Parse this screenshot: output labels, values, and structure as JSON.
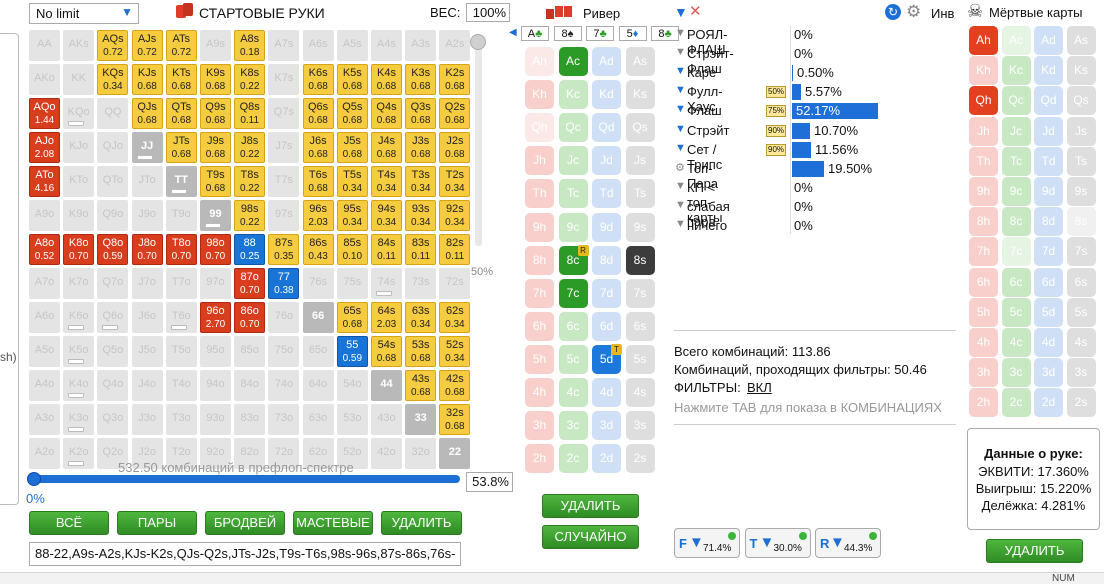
{
  "top": {
    "limit": "No limit",
    "title": "СТАРТОВЫЕ РУКИ",
    "weight_label": "ВЕС:",
    "weight_value": "100%",
    "slider_pct": "50%"
  },
  "grid": [
    [
      [
        "AA",
        "",
        "",
        "e"
      ],
      [
        "AKs",
        "",
        "",
        "e"
      ],
      [
        "AQs",
        "0.72",
        "",
        "y"
      ],
      [
        "AJs",
        "0.72",
        "",
        "y"
      ],
      [
        "ATs",
        "0.72",
        "",
        "y"
      ],
      [
        "A9s",
        "",
        "",
        "e"
      ],
      [
        "A8s",
        "0.18",
        "",
        "y"
      ],
      [
        "A7s",
        "",
        "",
        "e"
      ],
      [
        "A6s",
        "",
        "",
        "e"
      ],
      [
        "A5s",
        "",
        "",
        "e"
      ],
      [
        "A4s",
        "",
        "",
        "e"
      ],
      [
        "A3s",
        "",
        "",
        "e"
      ],
      [
        "A2s",
        "",
        "",
        "e"
      ]
    ],
    [
      [
        "AKo",
        "",
        "",
        "e"
      ],
      [
        "KK",
        "",
        "",
        "e"
      ],
      [
        "KQs",
        "0.34",
        "",
        "y"
      ],
      [
        "KJs",
        "0.68",
        "",
        "y"
      ],
      [
        "KTs",
        "0.68",
        "",
        "y"
      ],
      [
        "K9s",
        "0.68",
        "",
        "y"
      ],
      [
        "K8s",
        "0.22",
        "",
        "y"
      ],
      [
        "K7s",
        "",
        "",
        "e"
      ],
      [
        "K6s",
        "0.68",
        "",
        "y"
      ],
      [
        "K5s",
        "0.68",
        "",
        "y"
      ],
      [
        "K4s",
        "0.68",
        "",
        "y"
      ],
      [
        "K3s",
        "0.68",
        "",
        "y"
      ],
      [
        "K2s",
        "0.68",
        "",
        "y"
      ]
    ],
    [
      [
        "AQo",
        "1.44",
        "",
        "r"
      ],
      [
        "KQo",
        "",
        "b",
        "e"
      ],
      [
        "QQ",
        "",
        "",
        "e"
      ],
      [
        "QJs",
        "0.68",
        "",
        "y"
      ],
      [
        "QTs",
        "0.68",
        "",
        "y"
      ],
      [
        "Q9s",
        "0.68",
        "",
        "y"
      ],
      [
        "Q8s",
        "0.11",
        "",
        "y"
      ],
      [
        "Q7s",
        "",
        "",
        "e"
      ],
      [
        "Q6s",
        "0.68",
        "",
        "y"
      ],
      [
        "Q5s",
        "0.68",
        "",
        "y"
      ],
      [
        "Q4s",
        "0.68",
        "",
        "y"
      ],
      [
        "Q3s",
        "0.68",
        "",
        "y"
      ],
      [
        "Q2s",
        "0.68",
        "",
        "y"
      ]
    ],
    [
      [
        "AJo",
        "2.08",
        "",
        "r"
      ],
      [
        "KJo",
        "",
        "",
        "e"
      ],
      [
        "QJo",
        "",
        "",
        "e"
      ],
      [
        "JJ",
        "",
        "b",
        "g"
      ],
      [
        "JTs",
        "0.68",
        "",
        "y"
      ],
      [
        "J9s",
        "0.68",
        "",
        "y"
      ],
      [
        "J8s",
        "0.22",
        "",
        "y"
      ],
      [
        "J7s",
        "",
        "",
        "e"
      ],
      [
        "J6s",
        "0.68",
        "",
        "y"
      ],
      [
        "J5s",
        "0.68",
        "",
        "y"
      ],
      [
        "J4s",
        "0.68",
        "",
        "y"
      ],
      [
        "J3s",
        "0.68",
        "",
        "y"
      ],
      [
        "J2s",
        "0.68",
        "",
        "y"
      ]
    ],
    [
      [
        "ATo",
        "4.16",
        "",
        "r"
      ],
      [
        "KTo",
        "",
        "",
        "e"
      ],
      [
        "QTo",
        "",
        "",
        "e"
      ],
      [
        "JTo",
        "",
        "",
        "e"
      ],
      [
        "TT",
        "",
        "b",
        "g"
      ],
      [
        "T9s",
        "0.68",
        "",
        "y"
      ],
      [
        "T8s",
        "0.22",
        "",
        "y"
      ],
      [
        "T7s",
        "",
        "",
        "e"
      ],
      [
        "T6s",
        "0.68",
        "",
        "y"
      ],
      [
        "T5s",
        "0.34",
        "",
        "y"
      ],
      [
        "T4s",
        "0.34",
        "",
        "y"
      ],
      [
        "T3s",
        "0.34",
        "",
        "y"
      ],
      [
        "T2s",
        "0.34",
        "",
        "y"
      ]
    ],
    [
      [
        "A9o",
        "",
        "",
        "e"
      ],
      [
        "K9o",
        "",
        "",
        "e"
      ],
      [
        "Q9o",
        "",
        "",
        "e"
      ],
      [
        "J9o",
        "",
        "",
        "e"
      ],
      [
        "T9o",
        "",
        "",
        "e"
      ],
      [
        "99",
        "",
        "b",
        "g"
      ],
      [
        "98s",
        "0.22",
        "",
        "y"
      ],
      [
        "97s",
        "",
        "",
        "e"
      ],
      [
        "96s",
        "2.03",
        "",
        "y"
      ],
      [
        "95s",
        "0.34",
        "",
        "y"
      ],
      [
        "94s",
        "0.34",
        "",
        "y"
      ],
      [
        "93s",
        "0.34",
        "",
        "y"
      ],
      [
        "92s",
        "0.34",
        "",
        "y"
      ]
    ],
    [
      [
        "A8o",
        "0.52",
        "",
        "r"
      ],
      [
        "K8o",
        "0.70",
        "",
        "r"
      ],
      [
        "Q8o",
        "0.59",
        "",
        "r"
      ],
      [
        "J8o",
        "0.70",
        "",
        "r"
      ],
      [
        "T8o",
        "0.70",
        "",
        "r"
      ],
      [
        "98o",
        "0.70",
        "",
        "r"
      ],
      [
        "88",
        "0.25",
        "",
        "u"
      ],
      [
        "87s",
        "0.35",
        "",
        "y"
      ],
      [
        "86s",
        "0.43",
        "",
        "y"
      ],
      [
        "85s",
        "0.10",
        "",
        "y"
      ],
      [
        "84s",
        "0.11",
        "",
        "y"
      ],
      [
        "83s",
        "0.11",
        "",
        "y"
      ],
      [
        "82s",
        "0.11",
        "",
        "y"
      ]
    ],
    [
      [
        "A7o",
        "",
        "",
        "e"
      ],
      [
        "K7o",
        "",
        "",
        "e"
      ],
      [
        "Q7o",
        "",
        "",
        "e"
      ],
      [
        "J7o",
        "",
        "",
        "e"
      ],
      [
        "T7o",
        "",
        "",
        "e"
      ],
      [
        "97o",
        "",
        "",
        "e"
      ],
      [
        "87o",
        "0.70",
        "",
        "r"
      ],
      [
        "77",
        "0.38",
        "",
        "u"
      ],
      [
        "76s",
        "",
        "",
        "e"
      ],
      [
        "75s",
        "",
        "",
        "e"
      ],
      [
        "74s",
        "",
        "b",
        "e"
      ],
      [
        "73s",
        "",
        "",
        "e"
      ],
      [
        "72s",
        "",
        "",
        "e"
      ]
    ],
    [
      [
        "A6o",
        "",
        "",
        "e"
      ],
      [
        "K6o",
        "",
        "b",
        "e"
      ],
      [
        "Q6o",
        "",
        "b",
        "e"
      ],
      [
        "J6o",
        "",
        "",
        "e"
      ],
      [
        "T6o",
        "",
        "b",
        "e"
      ],
      [
        "96o",
        "2.70",
        "",
        "r"
      ],
      [
        "86o",
        "0.70",
        "",
        "r"
      ],
      [
        "76o",
        "",
        "",
        "e"
      ],
      [
        "66",
        "",
        "",
        "g"
      ],
      [
        "65s",
        "0.68",
        "",
        "y"
      ],
      [
        "64s",
        "2.03",
        "",
        "y"
      ],
      [
        "63s",
        "0.34",
        "",
        "y"
      ],
      [
        "62s",
        "0.34",
        "",
        "y"
      ]
    ],
    [
      [
        "A5o",
        "",
        "",
        "e"
      ],
      [
        "K5o",
        "",
        "b",
        "e"
      ],
      [
        "Q5o",
        "",
        "",
        "e"
      ],
      [
        "J5o",
        "",
        "",
        "e"
      ],
      [
        "T5o",
        "",
        "",
        "e"
      ],
      [
        "95o",
        "",
        "",
        "e"
      ],
      [
        "85o",
        "",
        "",
        "e"
      ],
      [
        "75o",
        "",
        "",
        "e"
      ],
      [
        "65o",
        "",
        "",
        "e"
      ],
      [
        "55",
        "0.59",
        "",
        "u"
      ],
      [
        "54s",
        "0.68",
        "",
        "y"
      ],
      [
        "53s",
        "0.68",
        "",
        "y"
      ],
      [
        "52s",
        "0.34",
        "",
        "y"
      ]
    ],
    [
      [
        "A4o",
        "",
        "",
        "e"
      ],
      [
        "K4o",
        "",
        "b",
        "e"
      ],
      [
        "Q4o",
        "",
        "",
        "e"
      ],
      [
        "J4o",
        "",
        "",
        "e"
      ],
      [
        "T4o",
        "",
        "",
        "e"
      ],
      [
        "94o",
        "",
        "",
        "e"
      ],
      [
        "84o",
        "",
        "",
        "e"
      ],
      [
        "74o",
        "",
        "",
        "e"
      ],
      [
        "64o",
        "",
        "",
        "e"
      ],
      [
        "54o",
        "",
        "",
        "e"
      ],
      [
        "44",
        "",
        "",
        "g"
      ],
      [
        "43s",
        "0.68",
        "",
        "y"
      ],
      [
        "42s",
        "0.68",
        "",
        "y"
      ]
    ],
    [
      [
        "A3o",
        "",
        "",
        "e"
      ],
      [
        "K3o",
        "",
        "b",
        "e"
      ],
      [
        "Q3o",
        "",
        "",
        "e"
      ],
      [
        "J3o",
        "",
        "",
        "e"
      ],
      [
        "T3o",
        "",
        "",
        "e"
      ],
      [
        "93o",
        "",
        "",
        "e"
      ],
      [
        "83o",
        "",
        "",
        "e"
      ],
      [
        "73o",
        "",
        "",
        "e"
      ],
      [
        "63o",
        "",
        "",
        "e"
      ],
      [
        "53o",
        "",
        "",
        "e"
      ],
      [
        "43o",
        "",
        "",
        "e"
      ],
      [
        "33",
        "",
        "",
        "g"
      ],
      [
        "32s",
        "0.68",
        "",
        "y"
      ]
    ],
    [
      [
        "A2o",
        "",
        "",
        "e"
      ],
      [
        "K2o",
        "",
        "b",
        "e"
      ],
      [
        "Q2o",
        "",
        "",
        "e"
      ],
      [
        "J2o",
        "",
        "",
        "e"
      ],
      [
        "T2o",
        "",
        "",
        "e"
      ],
      [
        "92o",
        "",
        "",
        "e"
      ],
      [
        "82o",
        "",
        "",
        "e"
      ],
      [
        "72o",
        "",
        "",
        "e"
      ],
      [
        "62o",
        "",
        "",
        "e"
      ],
      [
        "52o",
        "",
        "",
        "e"
      ],
      [
        "42o",
        "",
        "",
        "e"
      ],
      [
        "32o",
        "",
        "",
        "e"
      ],
      [
        "22",
        "",
        "",
        "g"
      ]
    ]
  ],
  "range": {
    "combos_text": "532.50 комбинаций в префлоп-спектре",
    "left_pct": "0%",
    "right_pct": "53.8%",
    "range_text": "88-22,A9s-A2s,KJs-K2s,QJs-Q2s,JTs-J2s,T9s-T6s,98s-96s,87s-86s,76s-"
  },
  "buttons": {
    "all": "ВСЁ",
    "pairs": "ПАРЫ",
    "broadway": "БРОДВЕЙ",
    "suited": "МАСТЕВЫЕ",
    "delete": "УДАЛИТЬ"
  },
  "river": {
    "title": "Ривер",
    "board": [
      {
        "rank": "A",
        "suit": "♣",
        "color": "#2c9a26"
      },
      {
        "rank": "8",
        "suit": "♠",
        "color": "#222222"
      },
      {
        "rank": "7",
        "suit": "♣",
        "color": "#2c9a26"
      },
      {
        "rank": "5",
        "suit": "♦",
        "color": "#1d78db"
      },
      {
        "rank": "8",
        "suit": "♣",
        "color": "#2c9a26"
      }
    ],
    "ranks": [
      "A",
      "K",
      "Q",
      "J",
      "T",
      "9",
      "8",
      "7",
      "6",
      "5",
      "4",
      "3",
      "2"
    ],
    "suits": [
      "h",
      "c",
      "d",
      "s"
    ],
    "selected": {
      "Ac": "on",
      "8c": "on",
      "7c": "on",
      "5d": "on",
      "8s": "on",
      "Ah": "faint",
      "Qh": "faint"
    },
    "marks": {
      "8c": "R",
      "5d": "T"
    },
    "delete": "УДАЛИТЬ",
    "random": "СЛУЧАЙНО"
  },
  "filters": {
    "inv": "Инв",
    "rows": [
      {
        "name": "РОЯЛ-ФЛАШ",
        "pct": "0%",
        "badge": "",
        "bar": 0,
        "icon": "filter-icon-gray"
      },
      {
        "name": "Стрэйт-Флаш",
        "pct": "0%",
        "badge": "",
        "bar": 0,
        "icon": "filter-icon-gray"
      },
      {
        "name": "Каре",
        "pct": "0.50%",
        "badge": "",
        "bar": 0.5,
        "icon": "filter-icon-blue"
      },
      {
        "name": "Фулл-Хаус",
        "pct": "5.57%",
        "badge": "50%",
        "bar": 5.57,
        "icon": "filter-icon-blue"
      },
      {
        "name": "Флаш",
        "pct": "52.17%",
        "badge": "75%",
        "bar": 52.17,
        "icon": "filter-icon-blue"
      },
      {
        "name": "Стрэйт",
        "pct": "10.70%",
        "badge": "90%",
        "bar": 10.7,
        "icon": "filter-icon-blue"
      },
      {
        "name": "Сет / Трипс",
        "pct": "11.56%",
        "badge": "90%",
        "bar": 11.56,
        "icon": "filter-icon-blue"
      },
      {
        "name": "Топ-Пара",
        "pct": "19.50%",
        "badge": "",
        "bar": 19.5,
        "icon": "gear-icon"
      },
      {
        "name": "КП < топ-карты",
        "pct": "0%",
        "badge": "",
        "bar": 0,
        "icon": "filter-icon-gray"
      },
      {
        "name": "слабая пара",
        "pct": "0%",
        "badge": "",
        "bar": 0,
        "icon": "filter-icon-gray"
      },
      {
        "name": "ничего",
        "pct": "0%",
        "badge": "",
        "bar": 0,
        "icon": "filter-icon-gray"
      }
    ],
    "total": "Всего комбинаций: 113.86",
    "passing": "Комбинаций, проходящих фильтры: 50.46",
    "filters_label": "ФИЛЬТРЫ:",
    "filters_value": "ВКЛ",
    "hint": "Нажмите TAB для показа в КОМБИНАЦИЯХ",
    "bottom": [
      {
        "letter": "F",
        "pct": "71.4%"
      },
      {
        "letter": "T",
        "pct": "30.0%"
      },
      {
        "letter": "R",
        "pct": "44.3%"
      }
    ]
  },
  "dead": {
    "title": "Мёртвые карты",
    "selected": {
      "Ah": "on",
      "Qh": "on",
      "Ac": "faint",
      "7c": "faint",
      "8s": "faint"
    },
    "info_title": "Данные о руке:",
    "equity": "ЭКВИТИ: 17.360%",
    "win": "Выигрыш: 15.220%",
    "tie": "Делёжка: 4.281%",
    "delete": "УДАЛИТЬ"
  },
  "status": {
    "num": "NUM",
    "left_text": "sh)"
  }
}
